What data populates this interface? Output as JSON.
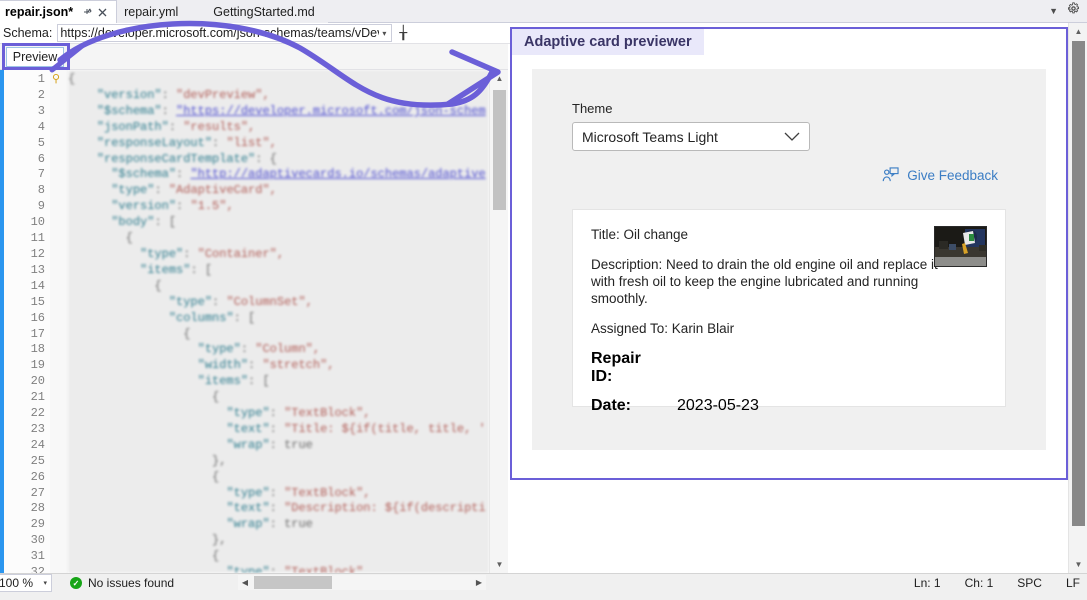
{
  "window": {
    "tabs": [
      {
        "label": "repair.json*",
        "active": true,
        "icons": [
          "pin-icon",
          "close-icon"
        ]
      },
      {
        "label": "repair.yml",
        "active": false,
        "icons": []
      },
      {
        "label": "GettingStarted.md",
        "active": false,
        "icons": []
      }
    ],
    "top_right_icons": [
      "chevron-down-icon",
      "gear-icon"
    ]
  },
  "schema_bar": {
    "label": "Schema:",
    "url": "https://developer.microsoft.com/json-schemas/teams/vDevPreview/MicrosoftTeams.F",
    "dropdown_caret": "▾",
    "splitter_icon": "╁"
  },
  "toolbar": {
    "preview_label": "Preview"
  },
  "editor": {
    "line_numbers": [
      1,
      2,
      3,
      4,
      5,
      6,
      7,
      8,
      9,
      10,
      11,
      12,
      13,
      14,
      15,
      16,
      17,
      18,
      19,
      20,
      21,
      22,
      23,
      24,
      25,
      26,
      27,
      28,
      29,
      30,
      31,
      32
    ],
    "lines": [
      "{",
      "    \"version\": \"devPreview\",",
      "    \"$schema\": \"https://developer.microsoft.com/json-schem",
      "    \"jsonPath\": \"results\",",
      "    \"responseLayout\": \"list\",",
      "    \"responseCardTemplate\": {",
      "      \"$schema\": \"http://adaptivecards.io/schemas/adaptive",
      "      \"type\": \"AdaptiveCard\",",
      "      \"version\": \"1.5\",",
      "      \"body\": [",
      "        {",
      "          \"type\": \"Container\",",
      "          \"items\": [",
      "            {",
      "              \"type\": \"ColumnSet\",",
      "              \"columns\": [",
      "                {",
      "                  \"type\": \"Column\",",
      "                  \"width\": \"stretch\",",
      "                  \"items\": [",
      "                    {",
      "                      \"type\": \"TextBlock\",",
      "                      \"text\": \"Title: ${if(title, title, '",
      "                      \"wrap\": true",
      "                    },",
      "                    {",
      "                      \"type\": \"TextBlock\",",
      "                      \"text\": \"Description: ${if(descripti",
      "                      \"wrap\": true",
      "                    },",
      "                    {",
      "                      \"type\": \"TextBlock\","
    ]
  },
  "preview_panel": {
    "title": "Adaptive card previewer",
    "theme_label": "Theme",
    "theme_value": "Microsoft Teams Light",
    "theme_chevron": "⌄",
    "feedback_label": "Give Feedback",
    "feedback_icon": "person-feedback-icon",
    "card": {
      "title": "Title: Oil change",
      "description": "Description: Need to drain the old engine oil and replace it with fresh oil to keep the engine lubricated and running smoothly.",
      "assigned": "Assigned To: Karin Blair",
      "facts": [
        {
          "name": "Repair ID:",
          "value": ""
        },
        {
          "name": "Date:",
          "value": "2023-05-23"
        }
      ],
      "thumbnail_alt": "car-oil-change-photo"
    }
  },
  "status_bar": {
    "zoom": "100 %",
    "zoom_caret": "▾",
    "issues": "No issues found",
    "issues_icon": "check-circle-icon",
    "line": "Ln: 1",
    "column": "Ch: 1",
    "spaces": "SPC",
    "line_ending": "LF"
  },
  "annotations": {
    "accent_color": "#6b5fd8",
    "highlight_preview_button": true,
    "highlight_preview_panel": true,
    "arrow_from": "preview-button",
    "arrow_to": "preview-panel"
  }
}
